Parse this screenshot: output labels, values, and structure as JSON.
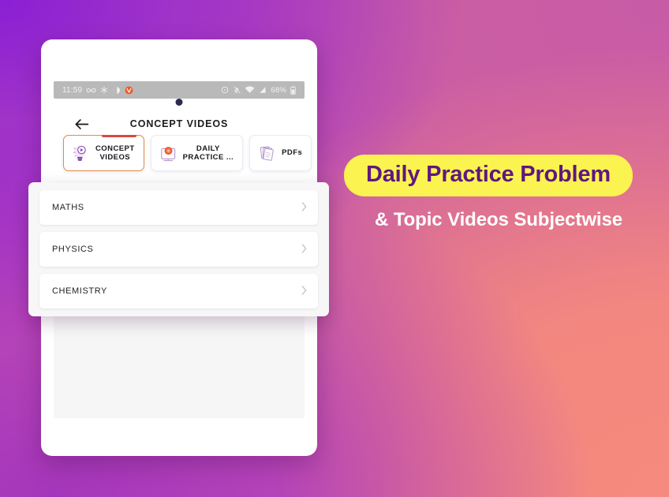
{
  "background": {
    "gradient_from": "#8e20d2",
    "gradient_mid": "#c95fa4",
    "gradient_to": "#f6897d"
  },
  "device": {
    "camera_icon": "camera-dot"
  },
  "status_bar": {
    "time": "11:59",
    "left_icons": [
      "infinity-icon",
      "snowflake-icon",
      "contrast-icon",
      "v-app-icon"
    ],
    "right_icons": [
      "alarm-icon",
      "notifications-off-icon",
      "wifi-icon",
      "signal-icon"
    ],
    "battery_text": "68%",
    "battery_icon": "battery-icon",
    "background_color": "#b9b9b9"
  },
  "header": {
    "back_icon": "back-arrow-icon",
    "title": "CONCEPT VIDEOS"
  },
  "tabs": [
    {
      "label": "CONCEPT\nVIDEOS",
      "icon": "lightbulb-play-icon",
      "active": true,
      "indicator_color": "#d64b3e",
      "border_color": "#e08a4e"
    },
    {
      "label": "DAILY\nPRACTICE ...",
      "icon": "clipboard-target-icon",
      "active": false
    },
    {
      "label": "PDFs",
      "icon": "paper-stack-icon",
      "active": false
    }
  ],
  "subjects": [
    {
      "label": "MATHS",
      "chevron": "chevron-right-icon"
    },
    {
      "label": "PHYSICS",
      "chevron": "chevron-right-icon"
    },
    {
      "label": "CHEMISTRY",
      "chevron": "chevron-right-icon"
    }
  ],
  "promo": {
    "headline": "Daily Practice Problem",
    "subline": "& Topic Videos Subjectwise",
    "pill_background": "#fbf350",
    "pill_text_color": "#5f177f",
    "subline_color": "#ffffff"
  }
}
